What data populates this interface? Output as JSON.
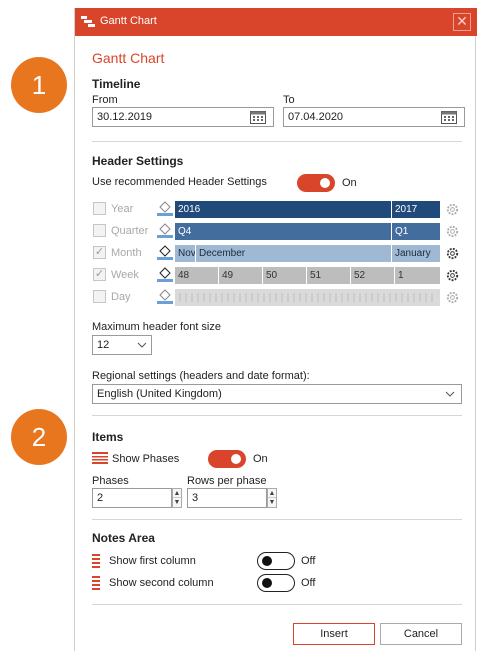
{
  "titlebar": {
    "title": "Gantt Chart",
    "close": "✕"
  },
  "badges": [
    "1",
    "2"
  ],
  "dialog_title": "Gantt Chart",
  "timeline": {
    "heading": "Timeline",
    "from_label": "From",
    "from_value": "30.12.2019",
    "to_label": "To",
    "to_value": "07.04.2020"
  },
  "header_settings": {
    "heading": "Header Settings",
    "recommended_label": "Use recommended Header Settings",
    "recommended_state": "On",
    "rows": [
      {
        "label": "Year",
        "checked": false,
        "bars": [
          "2016",
          "2017"
        ]
      },
      {
        "label": "Quarter",
        "checked": false,
        "bars": [
          "Q4",
          "Q1"
        ]
      },
      {
        "label": "Month",
        "checked": true,
        "bars": [
          "Nov",
          "December",
          "January"
        ]
      },
      {
        "label": "Week",
        "checked": true,
        "bars": [
          "48",
          "49",
          "50",
          "51",
          "52",
          "1"
        ]
      },
      {
        "label": "Day",
        "checked": false,
        "bars": []
      }
    ],
    "max_font_label": "Maximum header font size",
    "max_font_value": "12",
    "regional_label": "Regional settings (headers and date format):",
    "regional_value": "English (United Kingdom)"
  },
  "items": {
    "heading": "Items",
    "show_phases_label": "Show Phases",
    "show_phases_state": "On",
    "phases_label": "Phases",
    "phases_value": "2",
    "rows_label": "Rows per phase",
    "rows_value": "3"
  },
  "notes": {
    "heading": "Notes Area",
    "first_label": "Show first column",
    "first_state": "Off",
    "second_label": "Show second column",
    "second_state": "Off"
  },
  "buttons": {
    "insert": "Insert",
    "cancel": "Cancel"
  },
  "colors": {
    "accent": "#d9452b",
    "badge": "#e8761f",
    "dark_blue": "#1f4a79",
    "mid_blue": "#436d9c",
    "light_blue": "#9fb8d3"
  }
}
